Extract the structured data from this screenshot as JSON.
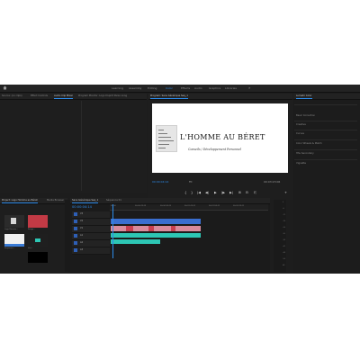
{
  "workspaces": {
    "tabs": [
      "Learning",
      "Assembly",
      "Editing",
      "Color",
      "Effects",
      "Audio",
      "Graphics",
      "Libraries"
    ],
    "active_index": 3
  },
  "source_panel": {
    "tabs": [
      "Source: (no clips)",
      "Effect Controls",
      "Audio Clip Mixer",
      "Program Monitor: Logo Dvpmt Perso Long"
    ],
    "active_index": 2
  },
  "program_panel": {
    "tab": "Program: Sans Générique Seq_1",
    "timecode_left": "00:00:04:14",
    "timecode_right": "00:03:23:06",
    "fit_label": "Fit"
  },
  "frame": {
    "title": "L'HOMME AU BÉRET",
    "subtitle": "Conseils / Développement Personnel"
  },
  "transport": {
    "controls": [
      "⇤",
      "{",
      "}",
      "|◀",
      "◀|",
      "▶",
      "|▶",
      "▶|",
      "⊞",
      "⊟",
      "⎘",
      "+"
    ]
  },
  "right_panel": {
    "title": "Lumetri Color",
    "sections": [
      "Basic Correction",
      "Creative",
      "Curves",
      "Color Wheels & Match",
      "HSL Secondary",
      "Vignette"
    ]
  },
  "project_panel": {
    "tabs": [
      "Project: Logo Homme au Béret",
      "Media Browser",
      "Libraries"
    ],
    "items": [
      "Logo Homme...",
      "Rouge...",
      "Séquence...",
      "Vert...",
      "Noir..."
    ]
  },
  "timeline": {
    "tabs": [
      "Sans Générique Seq_1",
      "Séquence 01"
    ],
    "timecode": "00:00:04:14",
    "video_tracks": [
      "V3",
      "V2",
      "V1"
    ],
    "audio_tracks": [
      "A1",
      "A2",
      "A3"
    ],
    "ruler": [
      "00:00",
      "00:00:29:23",
      "00:00:59:22",
      "00:01:29:21",
      "00:01:59:21",
      "00:02:29:21",
      "00:02:59:20"
    ]
  },
  "meter": {
    "ticks": [
      "0",
      "-6",
      "-12",
      "-18",
      "-24",
      "-30",
      "-36",
      "-42",
      "-48",
      "-54",
      "dB"
    ]
  },
  "colors": {
    "accent": "#2d8ceb",
    "clip_pink": "#d98b9c",
    "clip_teal": "#2dc6b4",
    "clip_red": "#c84050"
  }
}
